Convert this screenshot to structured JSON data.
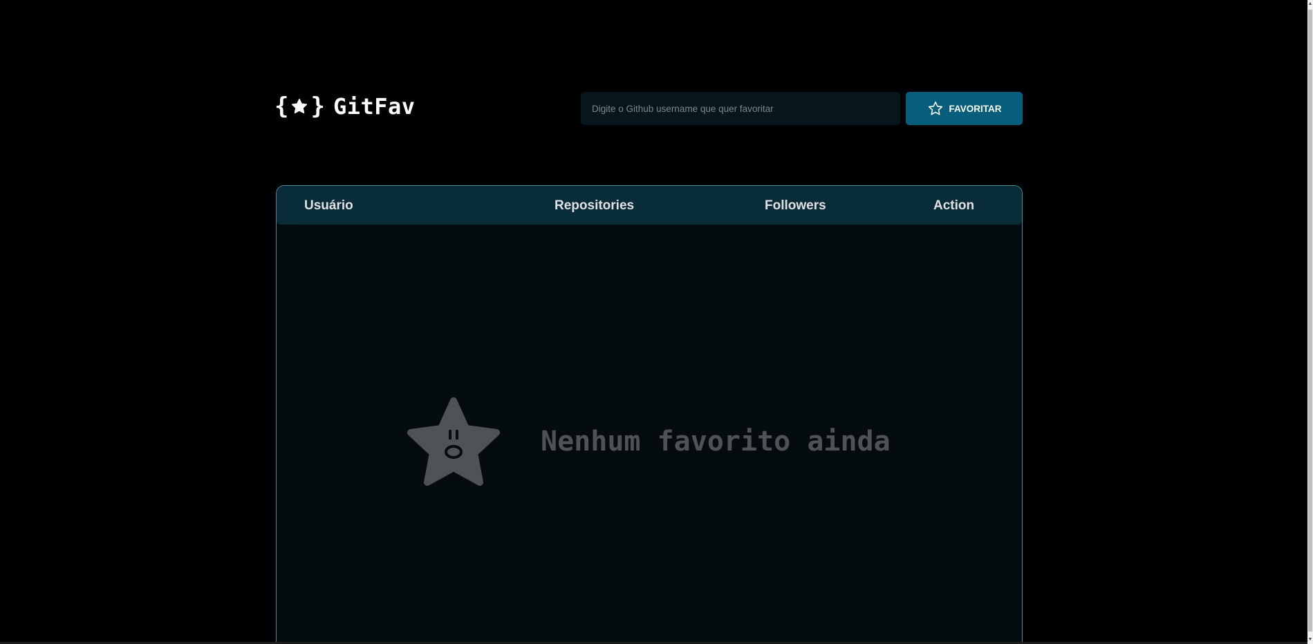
{
  "header": {
    "logo": {
      "brace_open": "{",
      "brace_close": "}",
      "name": "GitFav",
      "icon": "star-icon"
    },
    "search": {
      "placeholder": "Digite o Github username que quer favoritar",
      "value": ""
    },
    "favorite_button": {
      "label": "FAVORITAR",
      "icon": "star-outline-icon"
    }
  },
  "table": {
    "columns": [
      "Usuário",
      "Repositories",
      "Followers",
      "Action"
    ],
    "rows": [],
    "empty_state": {
      "message": "Nenhum favorito ainda",
      "icon": "sad-star-icon"
    }
  },
  "colors": {
    "background": "#000000",
    "accent": "#065e7c",
    "table_header": "#092d38",
    "table_border": "#4a8c99",
    "table_body": "#050c0f",
    "input_background": "#06161c",
    "empty_text": "#4e5455"
  }
}
